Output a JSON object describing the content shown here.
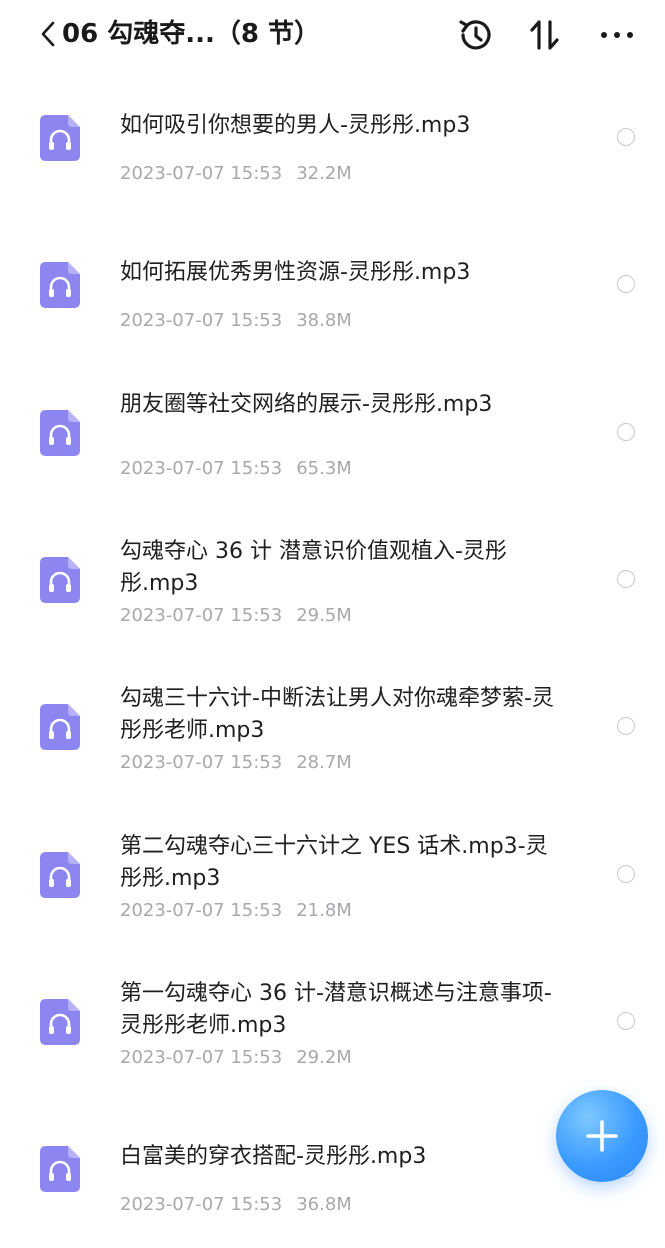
{
  "header": {
    "title": "06 勾魂夺...（8 节）"
  },
  "files": [
    {
      "name": "如何吸引你想要的男人-灵彤彤.mp3",
      "date": "2023-07-07 15:53",
      "size": "32.2M"
    },
    {
      "name": "如何拓展优秀男性资源-灵彤彤.mp3",
      "date": "2023-07-07 15:53",
      "size": "38.8M"
    },
    {
      "name": "朋友圈等社交网络的展示-灵彤彤.mp3",
      "date": "2023-07-07 15:53",
      "size": "65.3M"
    },
    {
      "name": "勾魂夺心 36 计 潜意识价值观植入-灵彤彤.mp3",
      "date": "2023-07-07 15:53",
      "size": "29.5M"
    },
    {
      "name": "勾魂三十六计-中断法让男人对你魂牵梦萦-灵彤彤老师.mp3",
      "date": "2023-07-07 15:53",
      "size": "28.7M"
    },
    {
      "name": "第二勾魂夺心三十六计之 YES 话术.mp3-灵彤彤.mp3",
      "date": "2023-07-07 15:53",
      "size": "21.8M"
    },
    {
      "name": "第一勾魂夺心 36 计-潜意识概述与注意事项-灵彤彤老师.mp3",
      "date": "2023-07-07 15:53",
      "size": "29.2M"
    },
    {
      "name": "白富美的穿衣搭配-灵彤彤.mp3",
      "date": "2023-07-07 15:53",
      "size": "36.8M"
    }
  ],
  "icons": {
    "back": "chevron-left-icon",
    "history": "history-icon",
    "sort": "sort-icon",
    "more": "more-dots-icon",
    "file": "audio-file-icon",
    "add": "plus-icon"
  },
  "colors": {
    "file_icon": "#8e86f0",
    "fab": "#3a9bff",
    "meta_text": "#a8a8ad"
  }
}
